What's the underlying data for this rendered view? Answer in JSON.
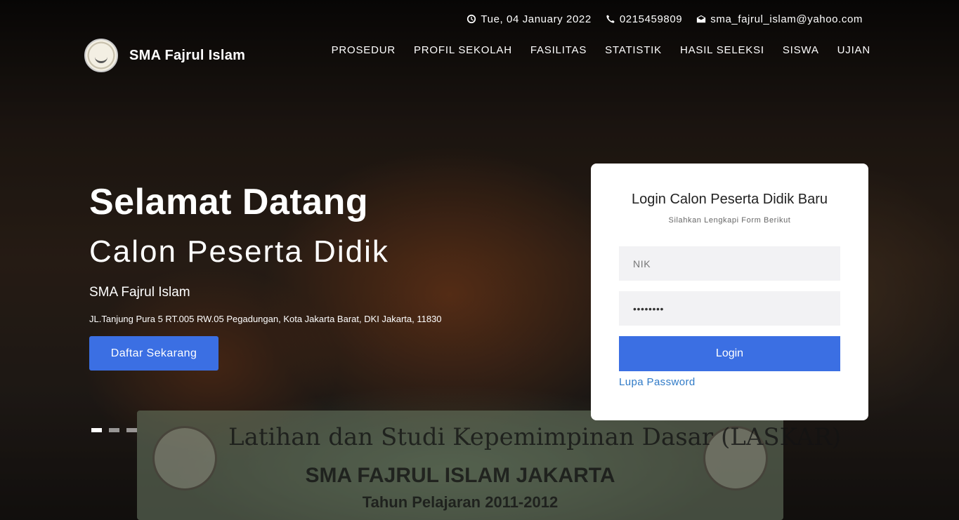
{
  "topbar": {
    "date": "Tue, 04 January 2022",
    "phone": "0215459809",
    "email": "sma_fajrul_islam@yahoo.com",
    "icons": [
      "clock-icon",
      "phone-icon",
      "envelope-icon"
    ]
  },
  "brand": {
    "name": "SMA Fajrul Islam"
  },
  "nav": {
    "items": [
      "PROSEDUR",
      "PROFIL SEKOLAH",
      "FASILITAS",
      "STATISTIK",
      "HASIL SELEKSI",
      "SISWA",
      "UJIAN"
    ]
  },
  "hero": {
    "title": "Selamat Datang",
    "subtitle": "Calon Peserta Didik",
    "school": "SMA Fajrul Islam",
    "address": "JL.Tanjung Pura 5 RT.005 RW.05 Pegadungan, Kota Jakarta Barat, DKI Jakarta, 11830",
    "cta": "Daftar Sekarang",
    "slides_count": 3,
    "active_slide": 1,
    "banner": {
      "line1": "Latihan dan Studi Kepemimpinan Dasar (LASKAR)",
      "line2": "SMA FAJRUL ISLAM JAKARTA",
      "line3": "Tahun Pelajaran 2011-2012"
    }
  },
  "login": {
    "title": "Login Calon Peserta Didik Baru",
    "subtitle": "Silahkan Lengkapi Form Berikut",
    "nik_placeholder": "NIK",
    "password_value": "********",
    "button": "Login",
    "forgot": "Lupa Password"
  },
  "colors": {
    "accent": "#3b6fe3",
    "link": "#2f7ac7"
  }
}
